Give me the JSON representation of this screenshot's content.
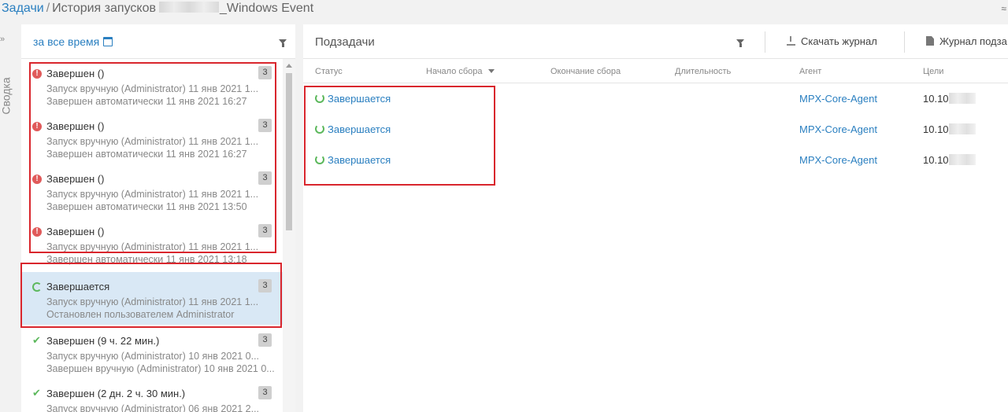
{
  "breadcrumb": {
    "root": "Задачи",
    "separator": "/",
    "page": "История запусков",
    "suffix": "_Windows Event"
  },
  "sidebar_strip": {
    "label": "Сводка",
    "chevron": "»"
  },
  "left_panel": {
    "period_label": "за все время",
    "items": [
      {
        "status": "error",
        "title": "Завершен ()",
        "count": "3",
        "line1": "Запуск вручную (Administrator) 11 янв 2021 1...",
        "line2": "Завершен автоматически 11 янв 2021 16:27"
      },
      {
        "status": "error",
        "title": "Завершен ()",
        "count": "3",
        "line1": "Запуск вручную (Administrator) 11 янв 2021 1...",
        "line2": "Завершен автоматически 11 янв 2021 16:27"
      },
      {
        "status": "error",
        "title": "Завершен ()",
        "count": "3",
        "line1": "Запуск вручную (Administrator) 11 янв 2021 1...",
        "line2": "Завершен автоматически 11 янв 2021 13:50"
      },
      {
        "status": "error",
        "title": "Завершен ()",
        "count": "3",
        "line1": "Запуск вручную (Administrator) 11 янв 2021 1...",
        "line2": "Завершен автоматически 11 янв 2021 13:18"
      },
      {
        "status": "running",
        "title": "Завершается",
        "count": "3",
        "line1": "Запуск вручную (Administrator) 11 янв 2021 1...",
        "line2": "Остановлен пользователем Administrator",
        "selected": true
      },
      {
        "status": "success",
        "title": "Завершен (9 ч. 22 мин.)",
        "count": "3",
        "line1": "Запуск вручную (Administrator) 10 янв 2021 0...",
        "line2": "Завершен вручную (Administrator) 10 янв 2021 0..."
      },
      {
        "status": "success",
        "title": "Завершен (2 дн. 2 ч. 30 мин.)",
        "count": "3",
        "line1": "Запуск вручную (Administrator) 06 янв 2021 2...",
        "line2": ""
      }
    ]
  },
  "right_panel": {
    "title": "Подзадачи",
    "download_label": "Скачать журнал",
    "log_label": "Журнал подза",
    "columns": [
      "Статус",
      "Начало сбора",
      "Окончание сбора",
      "Длительность",
      "Агент",
      "Цели"
    ],
    "rows": [
      {
        "status": "Завершается",
        "start": "",
        "end": "",
        "duration": "",
        "agent": "MPX-Core-Agent",
        "target": "10.10"
      },
      {
        "status": "Завершается",
        "start": "",
        "end": "",
        "duration": "",
        "agent": "MPX-Core-Agent",
        "target": "10.10"
      },
      {
        "status": "Завершается",
        "start": "",
        "end": "",
        "duration": "",
        "agent": "MPX-Core-Agent",
        "target": "10.10"
      }
    ]
  },
  "colors": {
    "link": "#2a7fc0",
    "error": "#e05a5a",
    "success": "#5cb85c",
    "selected_row": "#d9e8f5",
    "highlight": "#d9262d"
  }
}
